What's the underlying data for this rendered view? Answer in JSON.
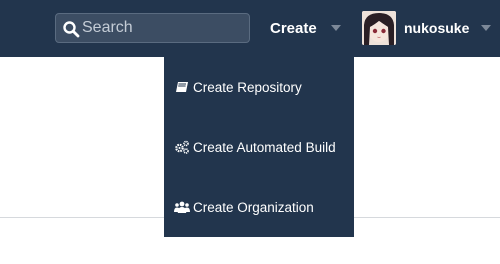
{
  "navbar": {
    "search": {
      "placeholder": "Search",
      "icon": "search-icon"
    },
    "create": {
      "label": "Create",
      "icon": "chevron-down-icon"
    },
    "user": {
      "name": "nukosuke",
      "avatar": "user-avatar",
      "icon": "chevron-down-icon"
    }
  },
  "create_menu": {
    "items": [
      {
        "label": "Create Repository",
        "icon": "book-icon"
      },
      {
        "label": "Create Automated Build",
        "icon": "gears-icon"
      },
      {
        "label": "Create Organization",
        "icon": "users-icon"
      }
    ]
  },
  "colors": {
    "navbar_bg": "#22354d",
    "dropdown_bg": "#22354d",
    "text": "#ffffff",
    "caret": "#7c8898"
  }
}
